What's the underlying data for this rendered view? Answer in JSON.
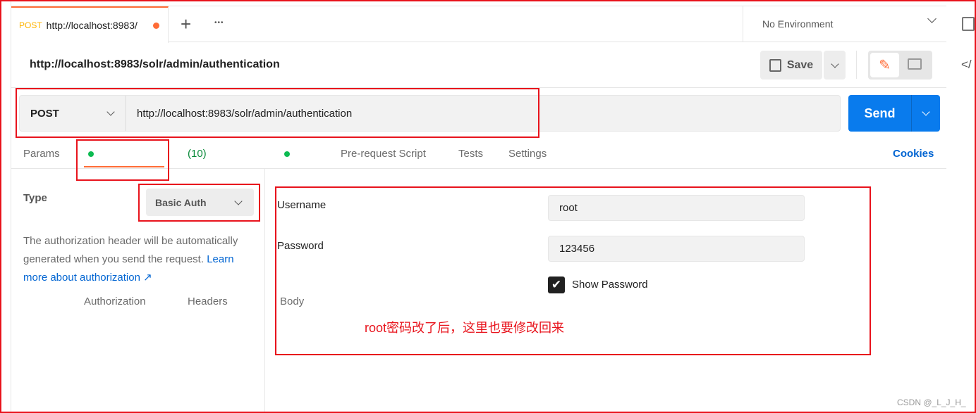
{
  "tab": {
    "method": "POST",
    "title": "http://localhost:8983/"
  },
  "toolbar": {
    "new_tab": "+",
    "more": "•••",
    "environment": "No Environment"
  },
  "request": {
    "title": "http://localhost:8983/solr/admin/authentication",
    "save_label": "Save",
    "method": "POST",
    "url": "http://localhost:8983/solr/admin/authentication",
    "send_label": "Send"
  },
  "tabs": [
    {
      "label": "Params"
    },
    {
      "label": "Authorization"
    },
    {
      "label": "Headers",
      "count": "(10)"
    },
    {
      "label": "Body"
    },
    {
      "label": "Pre-request Script"
    },
    {
      "label": "Tests"
    },
    {
      "label": "Settings"
    }
  ],
  "cookies": "Cookies",
  "auth": {
    "type_label": "Type",
    "type_value": "Basic Auth",
    "description": "The authorization header will be automatically generated when you send the request. ",
    "learn_more": "Learn more about authorization ↗",
    "username_label": "Username",
    "username_value": "root",
    "password_label": "Password",
    "password_value": "123456",
    "show_password_label": "Show Password",
    "show_password_checked": true
  },
  "annotation": "root密码改了后，这里也要修改回来",
  "watermark": "CSDN @_L_J_H_",
  "colors": {
    "accent": "#ff6c37",
    "send": "#097bed",
    "annotation": "#e8131c",
    "link": "#0265d2"
  }
}
